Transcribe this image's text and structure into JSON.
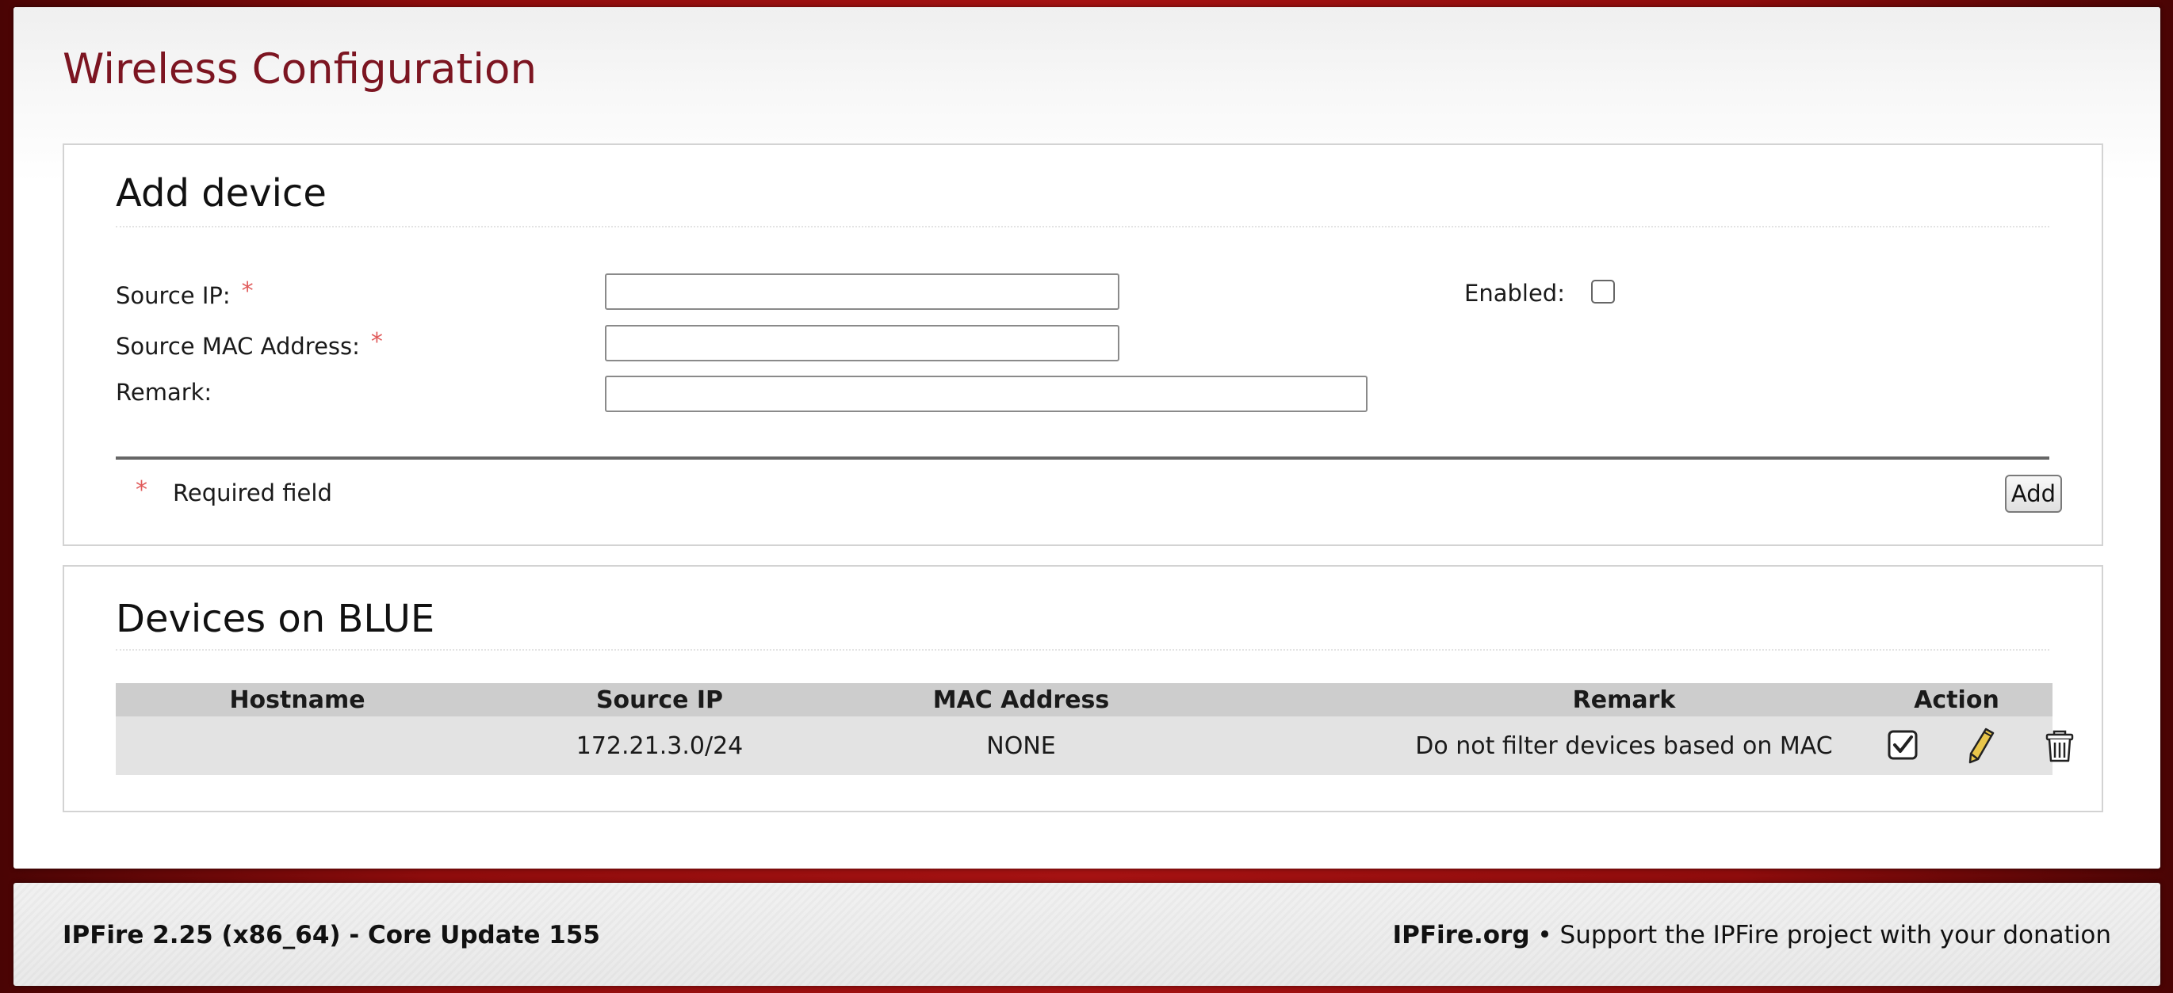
{
  "page": {
    "title": "Wireless Configuration"
  },
  "add_device": {
    "title": "Add device",
    "source_ip_label": "Source IP:",
    "source_ip_value": "",
    "source_mac_label": "Source MAC Address:",
    "source_mac_value": "",
    "remark_label": "Remark:",
    "remark_value": "",
    "required_marker": "*",
    "enabled_label": "Enabled:",
    "enabled_checked": false,
    "required_note": "Required field",
    "add_button": "Add"
  },
  "devices": {
    "title": "Devices on BLUE",
    "columns": [
      "Hostname",
      "Source IP",
      "MAC Address",
      "Remark",
      "Action"
    ],
    "rows": [
      {
        "hostname": "",
        "source_ip": "172.21.3.0/24",
        "mac_address": "NONE",
        "remark": "Do not filter devices based on MAC",
        "actions": [
          "checkbox-checked-icon",
          "pencil-edit-icon",
          "trash-delete-icon"
        ]
      }
    ]
  },
  "footer": {
    "version": "IPFire 2.25 (x86_64) - Core Update 155",
    "site": "IPFire.org",
    "separator": "•",
    "support_text": "Support the IPFire project with your donation"
  },
  "colors": {
    "title_red": "#7c1521",
    "required_star": "#e05a5a",
    "background_red": "#a51212",
    "table_header": "#cdcdcd",
    "table_row": "#e3e3e3",
    "edit_pencil": "#e9c64a"
  }
}
